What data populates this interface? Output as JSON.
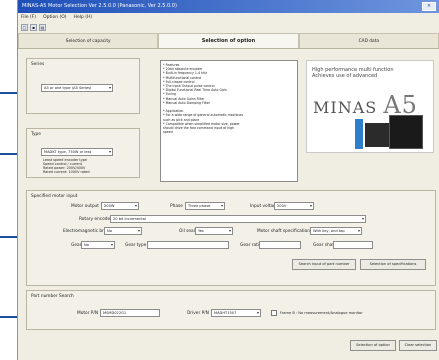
{
  "window": {
    "title": "MINAS-A5 Motor Selection Ver 2.5.0.0 (Panasonic, Ver 2.5.0.0)",
    "controls": "×"
  },
  "menu": [
    "File (F)",
    "Option (O)",
    "Help (H)"
  ],
  "toolbar": {
    "icons": [
      "open-icon",
      "save-icon",
      "print-icon"
    ]
  },
  "tabs": [
    {
      "label": "Selection of capacity",
      "active": false
    },
    {
      "label": "Selection of option",
      "active": true
    },
    {
      "label": "CAD data",
      "active": false
    }
  ],
  "series": {
    "label": "Series",
    "value": "A5 or one type (A5 Series)"
  },
  "type": {
    "label": "Type",
    "value": "MADKT type, 750W or less",
    "notes": [
      "Least speed encoder type",
      "Speed control / current",
      "Rated power: 200V/400V",
      "Rated current: 1000V rated"
    ]
  },
  "features": {
    "label": "Features",
    "items": [
      "* Features",
      "* 20bit absolute encoder",
      "* Built-in frequency 1-4 kHz",
      "* Multifunctional control",
      "* Full-closed control",
      "* The Input Output pulse control",
      "* Digital Functional Real Time Auto Gain",
      "* Tuning",
      "* Manual Auto Gains Filter",
      "* Manual Auto Damping Filter",
      "",
      "* Application",
      "* For a wide range of general automatic machines",
      "  such as pick and place",
      "* Compatible when simplified motor size, power",
      "  should drive the fast command input at high",
      "  speed"
    ]
  },
  "brand": {
    "tagline_1": "High performance multi function",
    "tagline_2": "Achieves use of advanced",
    "logo_text": "MINAS",
    "logo_big": "A5"
  },
  "spec_input": {
    "label": "Specified motor input",
    "motor_output": {
      "label": "Motor output",
      "value": "200W"
    },
    "phase": {
      "label": "Phase",
      "value": "Three phase"
    },
    "input_voltage": {
      "label": "Input voltage",
      "value": "200V"
    },
    "rotary_encoder": {
      "label": "Rotary encoder",
      "value": "20 bit incremental"
    },
    "electromagnetic_brake": {
      "label": "Electromagnetic brake",
      "value": "No"
    },
    "oil_seal": {
      "label": "Oil seal",
      "value": "Yes"
    },
    "motor_shaft_spec": {
      "label": "Motor shaft specifications",
      "value": "With key, and tap"
    },
    "gear": {
      "label": "Gear",
      "value": "No"
    },
    "gear_type": {
      "label": "Gear type"
    },
    "gear_ratio": {
      "label": "Gear ratio"
    },
    "gear_shaft": {
      "label": "Gear shaft"
    },
    "btn_search": "Search input of part number",
    "btn_select": "Selection of specifications"
  },
  "part_search": {
    "label": "Part number Search",
    "motor_pn": {
      "label": "Motor P/N",
      "value": "MSMD022G1"
    },
    "driver_pn": {
      "label": "Driver P/N",
      "value": "MADHT1507"
    },
    "frame_note": "Frame B : No measurement/Analogue monitor"
  },
  "footer": {
    "btn_selection": "Selection of option",
    "btn_clear": "Clear selection"
  },
  "colors": {
    "accent": "#1c4f9c",
    "titlebar": "#1d4fb8",
    "panel": "#f3f1e7"
  }
}
